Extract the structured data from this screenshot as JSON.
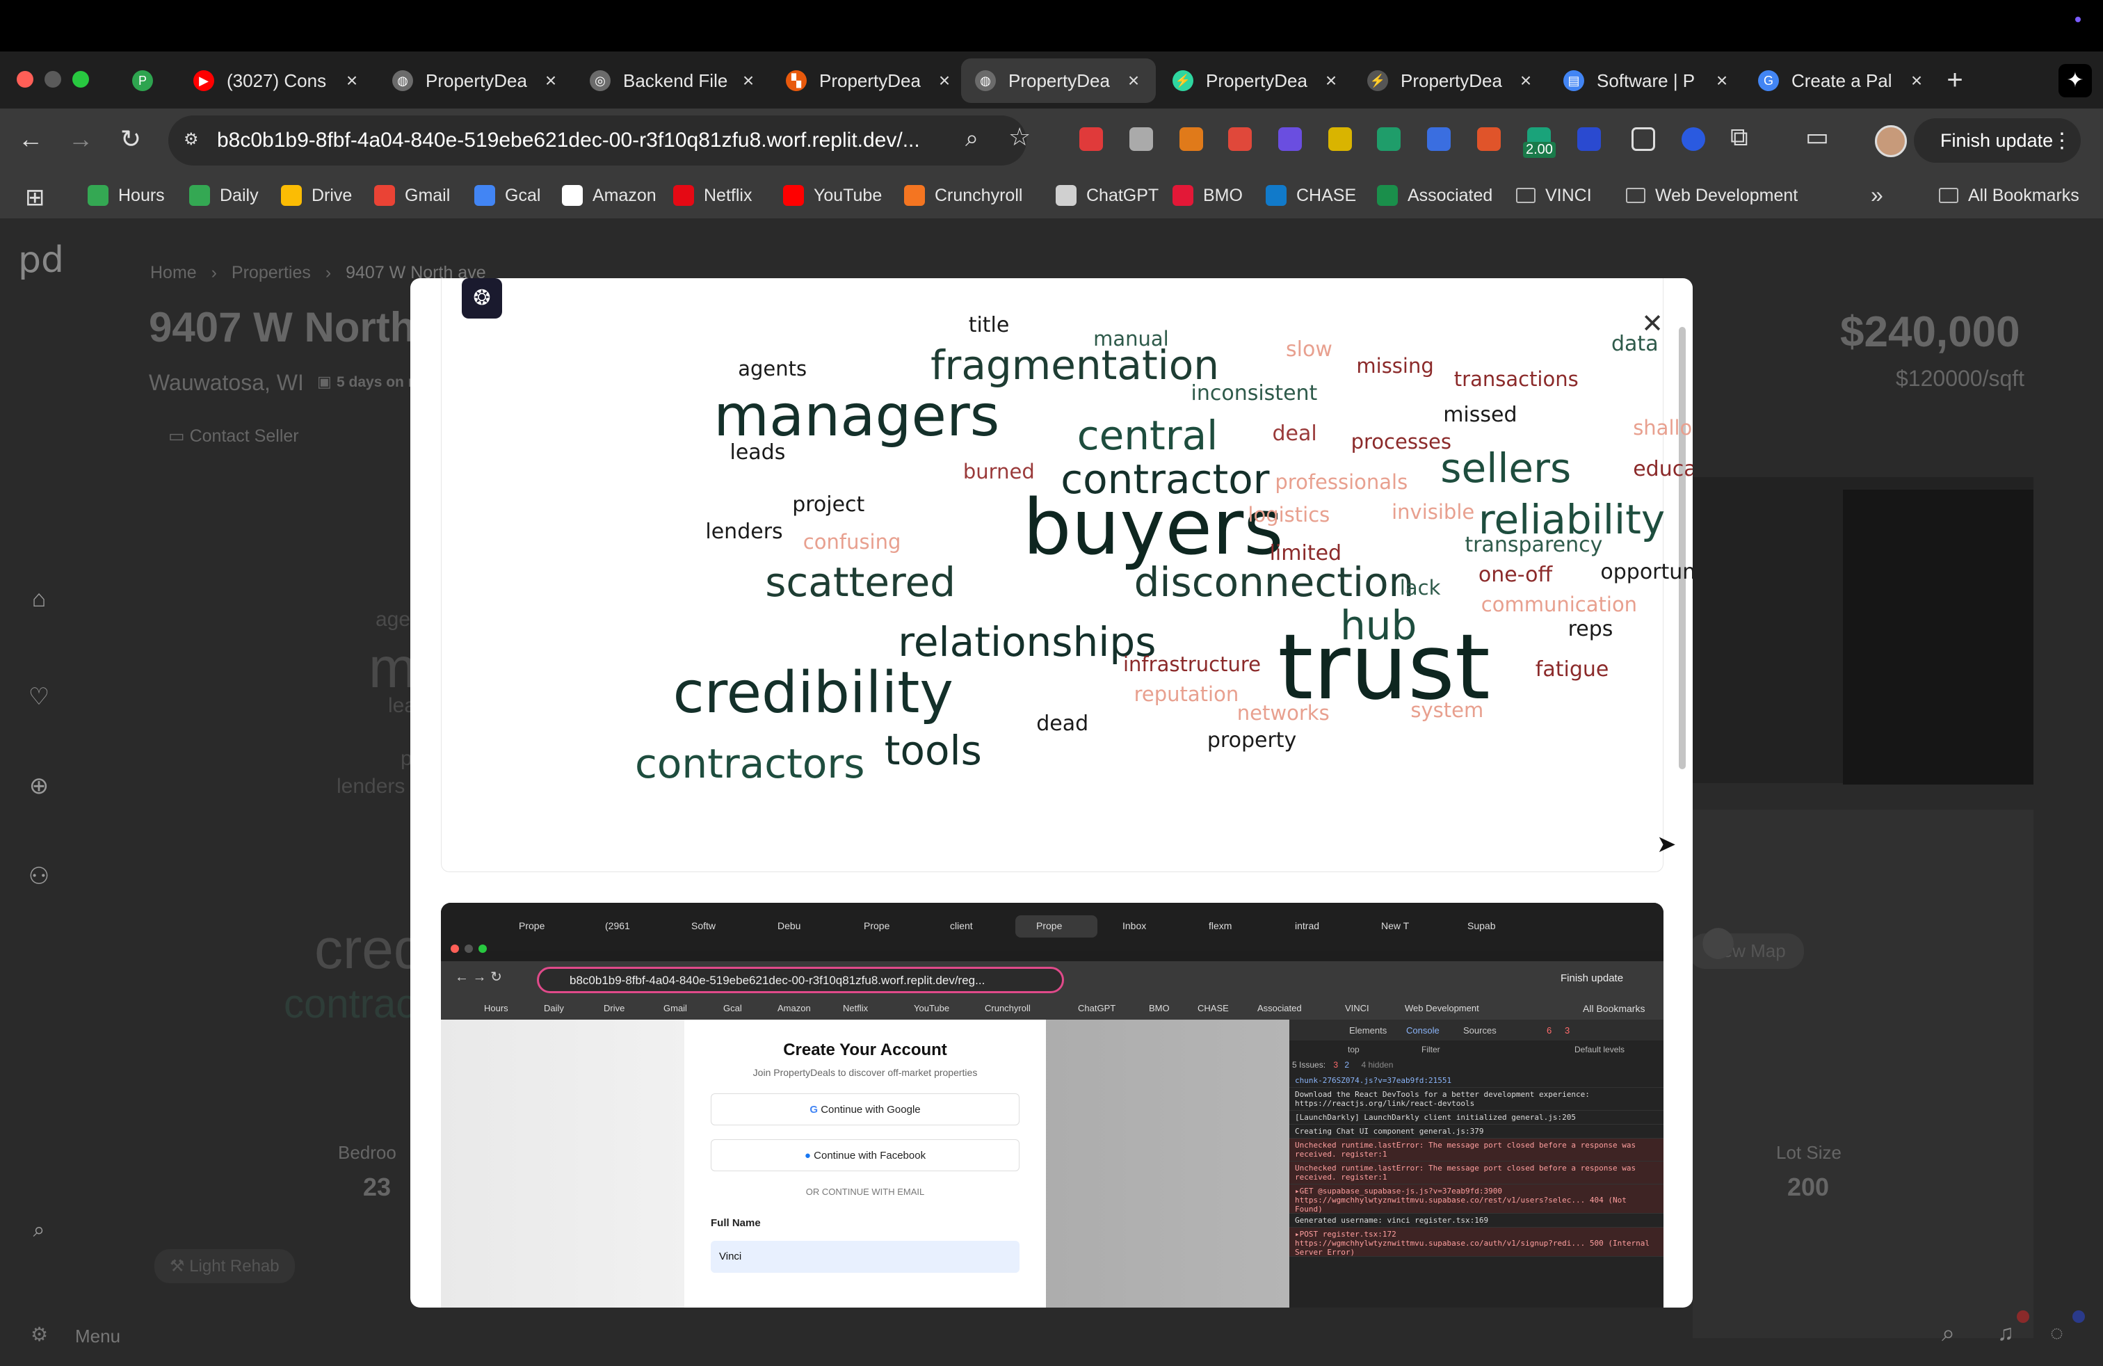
{
  "browser": {
    "tabs": [
      {
        "title": "",
        "fav_color": "#2ea44f",
        "fav_glyph": "P"
      },
      {
        "title": "(3027) Cons",
        "fav_color": "#ff0000",
        "fav_glyph": "▶"
      },
      {
        "title": "PropertyDea",
        "fav_color": "#6b6b6b",
        "fav_glyph": "◍"
      },
      {
        "title": "Backend File",
        "fav_color": "#6b6b6b",
        "fav_glyph": "◎"
      },
      {
        "title": "PropertyDea",
        "fav_color": "#e8590c",
        "fav_glyph": "▚"
      },
      {
        "title": "PropertyDea",
        "fav_color": "#6b6b6b",
        "fav_glyph": "◍"
      },
      {
        "title": "PropertyDea",
        "fav_color": "#2fd6a0",
        "fav_glyph": "⚡"
      },
      {
        "title": "PropertyDea",
        "fav_color": "#555555",
        "fav_glyph": "⚡"
      },
      {
        "title": "Software | P",
        "fav_color": "#4285f4",
        "fav_glyph": "▤"
      },
      {
        "title": "Create a Pal",
        "fav_color": "#4285f4",
        "fav_glyph": "G"
      }
    ],
    "url": "b8c0b1b9-8fbf-4a04-840e-519ebe621dec-00-r3f10q81zfu8.worf.replit.dev/...",
    "finish_update": "Finish update",
    "ext_badge": "2.00",
    "bookmarks": [
      {
        "label": "Hours",
        "color": "#34a853"
      },
      {
        "label": "Daily",
        "color": "#34a853"
      },
      {
        "label": "Drive",
        "color": "#fbbc04"
      },
      {
        "label": "Gmail",
        "color": "#ea4335"
      },
      {
        "label": "Gcal",
        "color": "#4285f4"
      },
      {
        "label": "Amazon",
        "color": "#ffffff"
      },
      {
        "label": "Netflix",
        "color": "#e50914"
      },
      {
        "label": "YouTube",
        "color": "#ff0000"
      },
      {
        "label": "Crunchyroll",
        "color": "#f47521"
      },
      {
        "label": "ChatGPT",
        "color": "#d0d0d0"
      },
      {
        "label": "BMO",
        "color": "#e31837"
      },
      {
        "label": "CHASE",
        "color": "#117aca"
      },
      {
        "label": "Associated",
        "color": "#1a8f4b"
      },
      {
        "label": "VINCI",
        "color": "#bbbbbb"
      },
      {
        "label": "Web Development",
        "color": "#bbbbbb"
      }
    ],
    "all_bookmarks": "All Bookmarks"
  },
  "page": {
    "logo": "pd",
    "breadcrumb": [
      "Home",
      "Properties",
      "9407 W North ave"
    ],
    "title": "9407 W North",
    "location": "Wauwatosa, WI",
    "listed": "5 days on m",
    "contact_seller": "Contact Seller",
    "price": "$240,000",
    "price_per_sqft": "$120000/sqft",
    "bedrooms_label": "Bedroo",
    "bedrooms_value": "23",
    "lot_size_label": "Lot Size",
    "lot_size_value": "200",
    "light_rehab": "Light Rehab",
    "view_map": "View Map",
    "menu": "Menu",
    "bg_words": [
      "age",
      "m",
      "lea",
      "p",
      "lenders",
      "cred",
      "contrac"
    ]
  },
  "modal": {
    "close": "✕",
    "words": [
      {
        "t": "title",
        "s": 30,
        "c": "#1a1a1a"
      },
      {
        "t": "manual",
        "s": 29,
        "c": "#2e5a4a"
      },
      {
        "t": "agents",
        "s": 29,
        "c": "#1a1a1a"
      },
      {
        "t": "fragmentation",
        "s": 58,
        "c": "#1e3d33"
      },
      {
        "t": "slow",
        "s": 30,
        "c": "#e8a08f"
      },
      {
        "t": "missing",
        "s": 29,
        "c": "#8b2a2a"
      },
      {
        "t": "data",
        "s": 30,
        "c": "#2e5a4a"
      },
      {
        "t": "transactions",
        "s": 29,
        "c": "#8b2a2a"
      },
      {
        "t": "inconsistent",
        "s": 30,
        "c": "#2e5a4a"
      },
      {
        "t": "managers",
        "s": 82,
        "c": "#14302a"
      },
      {
        "t": "missed",
        "s": 30,
        "c": "#1a1a1a"
      },
      {
        "t": "shallow",
        "s": 29,
        "c": "#e8a08f"
      },
      {
        "t": "central",
        "s": 58,
        "c": "#1e4d3e"
      },
      {
        "t": "deal",
        "s": 30,
        "c": "#9a3a3a"
      },
      {
        "t": "processes",
        "s": 29,
        "c": "#8b2a2a"
      },
      {
        "t": "leads",
        "s": 30,
        "c": "#1a1a1a"
      },
      {
        "t": "sellers",
        "s": 58,
        "c": "#1e4d3e"
      },
      {
        "t": "burned",
        "s": 29,
        "c": "#9a3a3a"
      },
      {
        "t": "contractor",
        "s": 58,
        "c": "#14302a"
      },
      {
        "t": "education",
        "s": 30,
        "c": "#8b2a2a"
      },
      {
        "t": "professionals",
        "s": 29,
        "c": "#e8a08f"
      },
      {
        "t": "project",
        "s": 30,
        "c": "#1a1a1a"
      },
      {
        "t": "reliability",
        "s": 58,
        "c": "#1e4d3e"
      },
      {
        "t": "buyers",
        "s": 110,
        "c": "#0e2620"
      },
      {
        "t": "logistics",
        "s": 29,
        "c": "#e8a08f"
      },
      {
        "t": "invisible",
        "s": 29,
        "c": "#e8a08f"
      },
      {
        "t": "lenders",
        "s": 30,
        "c": "#1a1a1a"
      },
      {
        "t": "confusing",
        "s": 29,
        "c": "#e8a08f"
      },
      {
        "t": "transparency",
        "s": 30,
        "c": "#2e5a4a"
      },
      {
        "t": "limited",
        "s": 30,
        "c": "#8b2a2a"
      },
      {
        "t": "opportunities",
        "s": 30,
        "c": "#1a1a1a"
      },
      {
        "t": "one-off",
        "s": 30,
        "c": "#8b2a2a"
      },
      {
        "t": "scattered",
        "s": 58,
        "c": "#1e3d33"
      },
      {
        "t": "disconnection",
        "s": 58,
        "c": "#1e3d33"
      },
      {
        "t": "lack",
        "s": 29,
        "c": "#2e5a4a"
      },
      {
        "t": "communication",
        "s": 29,
        "c": "#e8a08f"
      },
      {
        "t": "hub",
        "s": 58,
        "c": "#1e4d3e"
      },
      {
        "t": "relationships",
        "s": 58,
        "c": "#14302a"
      },
      {
        "t": "reps",
        "s": 30,
        "c": "#1a1a1a"
      },
      {
        "t": "trust",
        "s": 130,
        "c": "#0e2620"
      },
      {
        "t": "infrastructure",
        "s": 29,
        "c": "#8b2a2a"
      },
      {
        "t": "fatigue",
        "s": 30,
        "c": "#8b2a2a"
      },
      {
        "t": "credibility",
        "s": 82,
        "c": "#14302a"
      },
      {
        "t": "reputation",
        "s": 29,
        "c": "#e8a08f"
      },
      {
        "t": "system",
        "s": 29,
        "c": "#e8a08f"
      },
      {
        "t": "networks",
        "s": 29,
        "c": "#e8a08f"
      },
      {
        "t": "dead",
        "s": 30,
        "c": "#1a1a1a"
      },
      {
        "t": "tools",
        "s": 58,
        "c": "#14302a"
      },
      {
        "t": "contractors",
        "s": 58,
        "c": "#1e4d3e"
      },
      {
        "t": "property",
        "s": 30,
        "c": "#1a1a1a"
      }
    ]
  },
  "inner": {
    "tabs": [
      "Prope",
      "(2961",
      "Softw",
      "Debu",
      "Prope",
      "client",
      "Prope",
      "Inbox",
      "flexm",
      "intrad",
      "New T",
      "Supab"
    ],
    "url": "b8c0b1b9-8fbf-4a04-840e-519ebe621dec-00-r3f10q81zfu8.worf.replit.dev/reg...",
    "finish_update": "Finish update",
    "bookmarks": [
      "Hours",
      "Daily",
      "Drive",
      "Gmail",
      "Gcal",
      "Amazon",
      "Netflix",
      "YouTube",
      "Crunchyroll",
      "ChatGPT",
      "BMO",
      "CHASE",
      "Associated",
      "VINCI",
      "Web Development"
    ],
    "all_bookmarks": "All Bookmarks",
    "form": {
      "title": "Create Your Account",
      "subtitle": "Join PropertyDeals to discover off-market properties",
      "google": "Continue with Google",
      "facebook": "Continue with Facebook",
      "divider": "OR CONTINUE WITH EMAIL",
      "name_label": "Full Name",
      "name_value": "Vinci"
    },
    "devtools": {
      "tabs": [
        "Elements",
        "Console",
        "Sources"
      ],
      "errors": "6",
      "warnings": "3",
      "context": "top",
      "filter": "Filter",
      "levels": "Default levels",
      "issues": "5 Issues:",
      "issue_err": "3",
      "issue_warn": "2",
      "hidden": "4 hidden",
      "logs": [
        {
          "text": "chunk-276SZ074.js?v=37eab9fd:21551",
          "kind": "link"
        },
        {
          "text": "Download the React DevTools for a better development experience: https://reactjs.org/link/react-devtools",
          "kind": "info"
        },
        {
          "text": "[LaunchDarkly] LaunchDarkly client initialized  general.js:205",
          "kind": "info"
        },
        {
          "text": "Creating Chat UI component  general.js:379",
          "kind": "info"
        },
        {
          "text": "Unchecked runtime.lastError: The message port closed before a response was received.  register:1",
          "kind": "error"
        },
        {
          "text": "Unchecked runtime.lastError: The message port closed before a response was received.  register:1",
          "kind": "error"
        },
        {
          "text": "▸GET @supabase_supabase-js.js?v=37eab9fd:3900 https://wgmchhylwtyznwittmvu.supabase.co/rest/v1/users?selec... 404 (Not Found)",
          "kind": "error"
        },
        {
          "text": "Generated username: vinci  register.tsx:169",
          "kind": "info"
        },
        {
          "text": "▸POST register.tsx:172 https://wgmchhylwtyznwittmvu.supabase.co/auth/v1/signup?redi... 500 (Internal Server Error)",
          "kind": "error"
        }
      ]
    }
  }
}
